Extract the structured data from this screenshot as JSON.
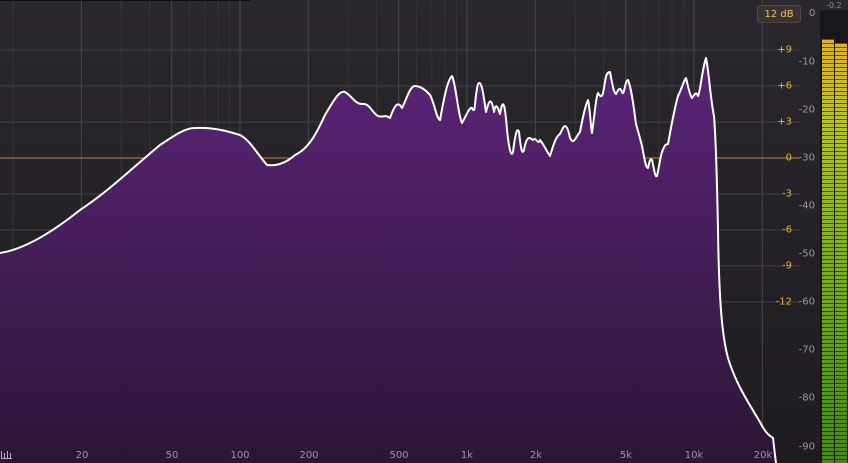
{
  "range_button": {
    "label": "12 dB"
  },
  "range_zero": "0",
  "peak_readout": "-0.2",
  "freq_labels": [
    "20",
    "50",
    "100",
    "200",
    "500",
    "1k",
    "2k",
    "5k",
    "10k",
    "20k"
  ],
  "eq_db_labels": [
    "+9",
    "+6",
    "+3",
    "0",
    "-3",
    "-6",
    "-9",
    "-12"
  ],
  "level_labels": [
    "-10",
    "-20",
    "-30",
    "-40",
    "-50",
    "-60",
    "-70",
    "-80",
    "-90"
  ],
  "colors": {
    "background": "#232026",
    "spectrum_fill_top": "#5c2478",
    "spectrum_fill_bottom": "#2b1636",
    "spectrum_line": "#ffffff",
    "eq_label": "#e3b43b",
    "zero_line": "#b08a3a"
  },
  "icons": {
    "scale": "analyzer-scale-icon"
  }
}
